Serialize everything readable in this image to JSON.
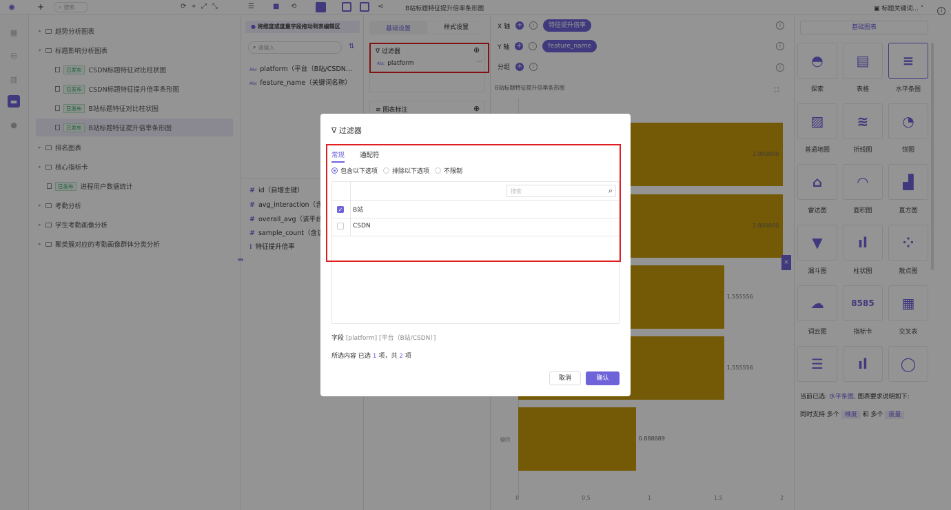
{
  "topbar": {
    "logo": "logo",
    "add": "+",
    "search_placeholder": "搜索",
    "doc_title": "B站标题特征提升倍率条形图",
    "user": "标题关键词..."
  },
  "tree": [
    {
      "label": "趋势分析图表",
      "type": "folder",
      "expanded": false,
      "indent": 0
    },
    {
      "label": "标题影响分析图表",
      "type": "folder",
      "expanded": true,
      "indent": 0
    },
    {
      "label": "CSDN标题特征对比柱状图",
      "type": "doc",
      "badge": "已发布",
      "indent": 1
    },
    {
      "label": "CSDN标题特征提升倍率条形图",
      "type": "doc",
      "badge": "已发布",
      "indent": 1
    },
    {
      "label": "B站标题特征对比柱状图",
      "type": "doc",
      "badge": "已发布",
      "indent": 1
    },
    {
      "label": "B站标题特征提升倍率条形图",
      "type": "doc",
      "badge": "已发布",
      "indent": 1,
      "selected": true
    },
    {
      "label": "排名图表",
      "type": "folder",
      "expanded": false,
      "indent": 0
    },
    {
      "label": "核心指标卡",
      "type": "folder",
      "expanded": false,
      "indent": 0
    },
    {
      "label": "进程用户数据统计",
      "type": "doc",
      "badge": "已发布",
      "indent": 0
    },
    {
      "label": "考勤分析",
      "type": "folder",
      "expanded": false,
      "indent": 0
    },
    {
      "label": "学生考勤画像分析",
      "type": "folder",
      "expanded": false,
      "indent": 0
    },
    {
      "label": "聚类簇对应的考勤画像群体分类分析",
      "type": "folder",
      "expanded": false,
      "indent": 0
    }
  ],
  "fieldpanel": {
    "hint": "将维度或度量字段拖动到表编辑区",
    "search_placeholder": "请输入",
    "dimensions": [
      "platform（平台（B站/CSDN...",
      "feature_name（关键词名称）"
    ],
    "measures": [
      "id（自增主键）",
      "avg_interaction（含该",
      "overall_avg（该平台整",
      "sample_count（含该",
      "特征提升倍率"
    ]
  },
  "setpanel": {
    "tab_basic": "基础设置",
    "tab_style": "样式设置",
    "filter_title": "过滤器",
    "filter_field": "platform",
    "marker_title": "图表标注"
  },
  "axes": {
    "x_label": "X 轴",
    "x_field": "特征提升倍率",
    "y_label": "Y 轴",
    "y_field": "feature_name",
    "group_label": "分组"
  },
  "chart_data": {
    "type": "bar",
    "orientation": "horizontal",
    "title": "B站标题特征提升倍率条形图",
    "categories": [
      "",
      "",
      "",
      "",
      "疑问"
    ],
    "values": [
      2.0,
      2.0,
      1.555556,
      1.555556,
      0.888889
    ],
    "value_labels": [
      "2.000000",
      "2.000000",
      "1.555556",
      "1.555556",
      "0.888889"
    ],
    "xticks": [
      "0",
      "0.5",
      "1",
      "1.5",
      "2"
    ],
    "xlim": [
      0,
      2.2
    ],
    "grid": false,
    "color": "#c99a0c"
  },
  "rightpanel": {
    "header": "基础图表",
    "types": [
      "探索",
      "表格",
      "水平条图",
      "普通地图",
      "折线图",
      "饼图",
      "雷达图",
      "面积图",
      "直方图",
      "漏斗图",
      "柱状图",
      "散点图",
      "词云图",
      "指标卡",
      "交叉表",
      "",
      "",
      ""
    ],
    "current_prefix": "当前已选:",
    "current_type": "水平条图",
    "current_suffix": ", 图表要求说明如下:",
    "req_prefix": "同时支持 多个",
    "req_dim": "维度",
    "req_mid": "和 多个",
    "req_measure": "度量"
  },
  "modal": {
    "title": "过滤器",
    "tab_normal": "常规",
    "tab_wildcard": "通配符",
    "opt_include": "包含以下选项",
    "opt_exclude": "排除以下选项",
    "opt_nolimit": "不限制",
    "search_placeholder": "搜索",
    "options": [
      {
        "label": "B站",
        "checked": true
      },
      {
        "label": "CSDN",
        "checked": false
      }
    ],
    "field_label": "字段",
    "field_value": "[platform] [平台（B站/CSDN）]",
    "selected_label": "所选内容",
    "selected_text": "已选",
    "selected_count": "1",
    "selected_mid": "项，共",
    "total_count": "2",
    "selected_end": "项",
    "cancel": "取消",
    "confirm": "确认"
  },
  "colors": {
    "accent": "#6e63d9",
    "bar": "#c99a0c",
    "highlight": "#e02020"
  }
}
